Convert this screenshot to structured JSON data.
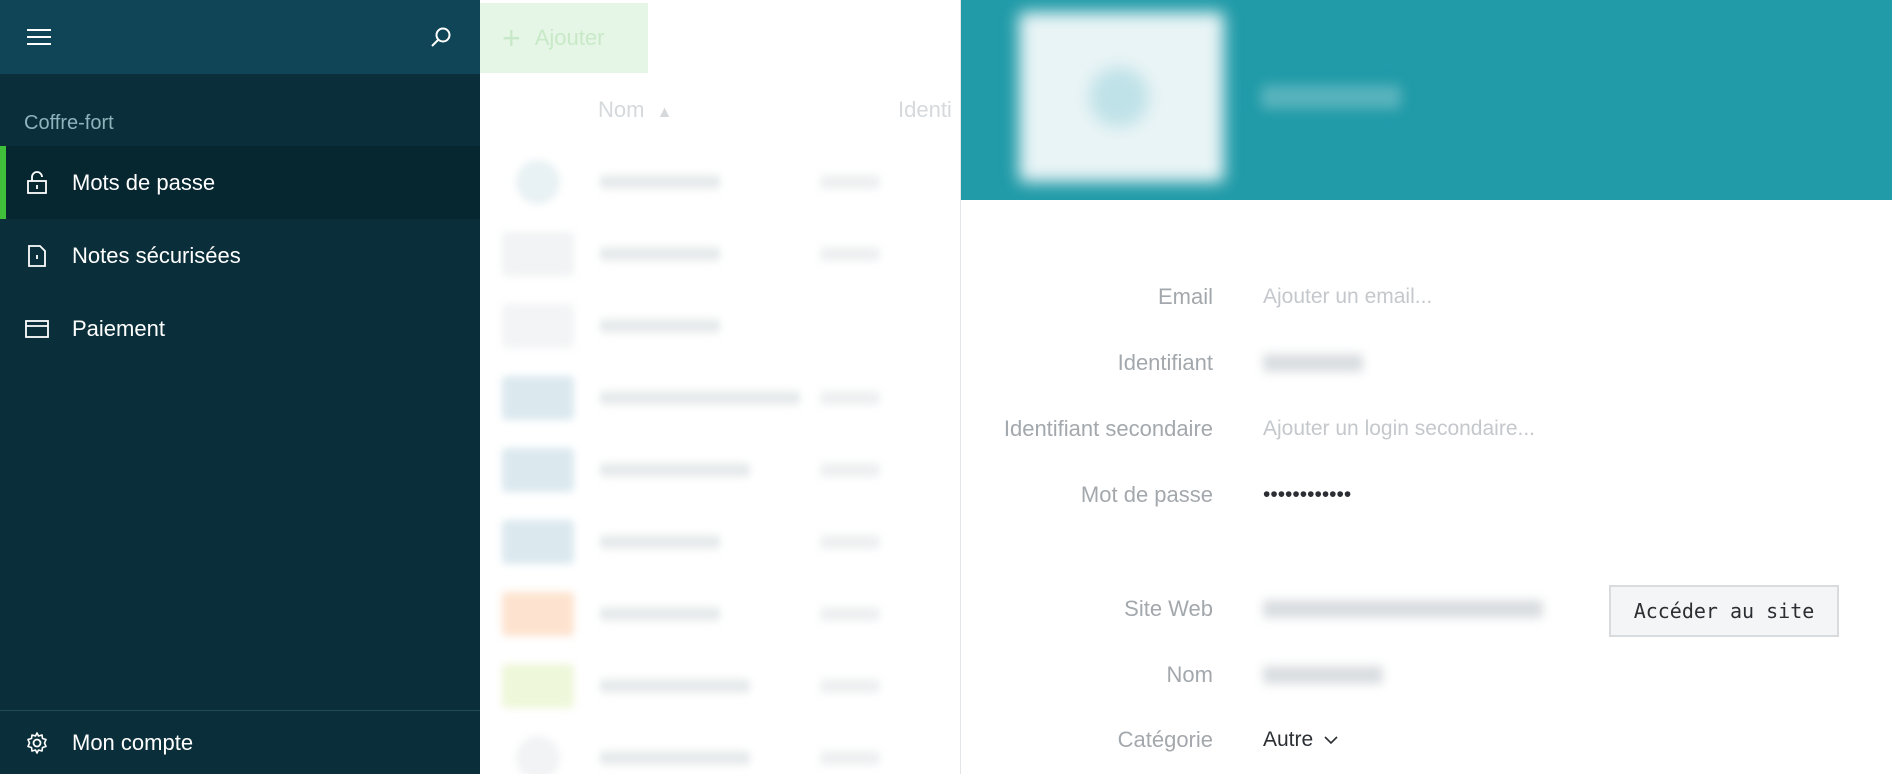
{
  "sidebar": {
    "section_label": "Coffre-fort",
    "items": [
      {
        "label": "Mots de passe",
        "icon": "lock-icon",
        "active": true
      },
      {
        "label": "Notes sécurisées",
        "icon": "note-icon",
        "active": false
      },
      {
        "label": "Paiement",
        "icon": "card-icon",
        "active": false
      }
    ],
    "account_label": "Mon compte",
    "accent_color": "#3fbf3a"
  },
  "list": {
    "add_label": "Ajouter",
    "col_name": "Nom",
    "col_identifier": "Identi",
    "logo_colors": [
      "#e8f1f3",
      "#f1f3f4",
      "#f3f4f5",
      "#dbe9ef",
      "#dbe9ef",
      "#dbe9ef",
      "#fde3cf",
      "#eef7d9",
      "#f1f3f4"
    ]
  },
  "detail": {
    "header_color": "#219ba8",
    "fields": {
      "email_label": "Email",
      "email_placeholder": "Ajouter un email...",
      "identifier_label": "Identifiant",
      "secondary_label": "Identifiant secondaire",
      "secondary_placeholder": "Ajouter un login secondaire...",
      "password_label": "Mot de passe",
      "password_value": "••••••••••••",
      "website_label": "Site Web",
      "go_button": "Accéder au site",
      "name_label": "Nom",
      "category_label": "Catégorie",
      "category_value": "Autre"
    }
  }
}
